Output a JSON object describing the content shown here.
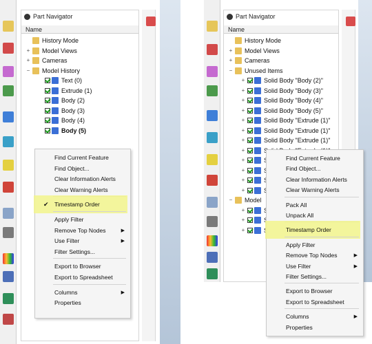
{
  "left": {
    "title": "Part Navigator",
    "column": "Name",
    "tree": [
      {
        "label": "History Mode",
        "indent": 0,
        "exp": ""
      },
      {
        "label": "Model Views",
        "indent": 0,
        "exp": "+"
      },
      {
        "label": "Cameras",
        "indent": 0,
        "exp": "+"
      },
      {
        "label": "Model History",
        "indent": 0,
        "exp": "-"
      },
      {
        "label": "Text (0)",
        "indent": 1,
        "exp": ""
      },
      {
        "label": "Extrude (1)",
        "indent": 1,
        "exp": ""
      },
      {
        "label": "Body (2)",
        "indent": 1,
        "exp": ""
      },
      {
        "label": "Body (3)",
        "indent": 1,
        "exp": ""
      },
      {
        "label": "Body (4)",
        "indent": 1,
        "exp": ""
      },
      {
        "label": "Body (5)",
        "indent": 1,
        "exp": ""
      }
    ],
    "menu": [
      {
        "label": "Find Current Feature"
      },
      {
        "label": "Find Object..."
      },
      {
        "label": "Clear Information Alerts"
      },
      {
        "label": "Clear Warning Alerts"
      },
      {
        "label": "Timestamp Order",
        "checked": true
      },
      {
        "label": "Apply Filter"
      },
      {
        "label": "Remove Top Nodes",
        "sub": true
      },
      {
        "label": "Use Filter",
        "sub": true
      },
      {
        "label": "Filter Settings..."
      },
      {
        "label": "Export to Browser"
      },
      {
        "label": "Export to Spreadsheet"
      },
      {
        "label": "Columns",
        "sub": true
      },
      {
        "label": "Properties"
      }
    ]
  },
  "right": {
    "title": "Part Navigator",
    "column": "Name",
    "tree": [
      {
        "label": "History Mode",
        "indent": 0,
        "exp": ""
      },
      {
        "label": "Model Views",
        "indent": 0,
        "exp": "+"
      },
      {
        "label": "Cameras",
        "indent": 0,
        "exp": "+"
      },
      {
        "label": "Unused Items",
        "indent": 0,
        "exp": "-"
      },
      {
        "label": "Solid Body \"Body (2)\"",
        "indent": 1,
        "exp": "+"
      },
      {
        "label": "Solid Body \"Body (3)\"",
        "indent": 1,
        "exp": "+"
      },
      {
        "label": "Solid Body \"Body (4)\"",
        "indent": 1,
        "exp": "+"
      },
      {
        "label": "Solid Body \"Body (5)\"",
        "indent": 1,
        "exp": "+"
      },
      {
        "label": "Solid Body \"Extrude (1)\"",
        "indent": 1,
        "exp": "+"
      },
      {
        "label": "Solid Body \"Extrude (1)\"",
        "indent": 1,
        "exp": "+"
      },
      {
        "label": "Solid Body \"Extrude (1)\"",
        "indent": 1,
        "exp": "+"
      },
      {
        "label": "Solid Body \"Extrude (1)\"",
        "indent": 1,
        "exp": "+"
      },
      {
        "label": "Solic",
        "indent": 1,
        "exp": "+"
      },
      {
        "label": "Solic",
        "indent": 1,
        "exp": "+"
      },
      {
        "label": "Solic",
        "indent": 1,
        "exp": "+"
      },
      {
        "label": "Solic",
        "indent": 1,
        "exp": "+"
      },
      {
        "label": "Model",
        "indent": 0,
        "exp": "-"
      },
      {
        "label": "Solic",
        "indent": 1,
        "exp": "+"
      },
      {
        "label": "Solic",
        "indent": 1,
        "exp": "+"
      },
      {
        "label": "Solic",
        "indent": 1,
        "exp": "+"
      }
    ],
    "menu": [
      {
        "label": "Find Current Feature"
      },
      {
        "label": "Find Object..."
      },
      {
        "label": "Clear Information Alerts"
      },
      {
        "label": "Clear Warning Alerts"
      },
      {
        "label": "Pack All"
      },
      {
        "label": "Unpack All"
      },
      {
        "label": "Timestamp Order"
      },
      {
        "label": "Apply Filter"
      },
      {
        "label": "Remove Top Nodes",
        "sub": true
      },
      {
        "label": "Use Filter",
        "sub": true
      },
      {
        "label": "Filter Settings..."
      },
      {
        "label": "Export to Browser"
      },
      {
        "label": "Export to Spreadsheet"
      },
      {
        "label": "Columns",
        "sub": true
      },
      {
        "label": "Properties"
      }
    ]
  },
  "colors": {
    "highlight": "#f2f58c",
    "check": "#1a9c1a",
    "body_icon": "#3b6fd6",
    "folder": "#e8c15a"
  }
}
